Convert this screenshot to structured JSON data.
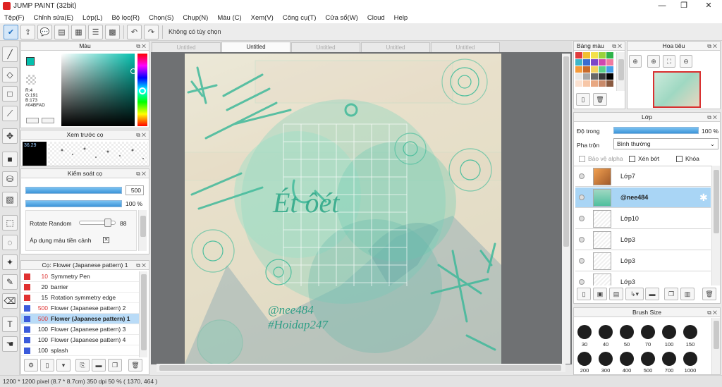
{
  "window": {
    "title": "JUMP PAINT (32bit)"
  },
  "menu": [
    "Tệp(F)",
    "Chỉnh sửa(E)",
    "Lớp(L)",
    "Bộ lọc(R)",
    "Chọn(S)",
    "Chụp(N)",
    "Màu (C)",
    "Xem(V)",
    "Công cụ(T)",
    "Cửa sổ(W)",
    "Cloud",
    "Help"
  ],
  "toolbar": {
    "hint": "Không có tùy chọn"
  },
  "tabs": [
    "Untitled",
    "Untitled",
    "Untitled",
    "Untitled",
    "Untitled"
  ],
  "color_panel": {
    "title": "Màu",
    "r": "R:4",
    "g": "G:191",
    "b": "B:173",
    "hex": "#04BFAD",
    "current": "#04bfad"
  },
  "brush_preview": {
    "title": "Xem trước cọ",
    "size": "36.29"
  },
  "brush_control": {
    "title": "Kiểm soát cọ",
    "size": "500",
    "opacity": "100 %",
    "rotate_label": "Rotate Random",
    "rotate_value": "88",
    "apply_label": "Áp dụng màu tiền cảnh"
  },
  "brush_list": {
    "title": "Cọ: Flower (Japanese pattern) 1",
    "items": [
      {
        "size": "10",
        "name": "Symmetry Pen",
        "color": "#e03131"
      },
      {
        "size": "20",
        "name": "barrier",
        "color": "#e03131"
      },
      {
        "size": "15",
        "name": "Rotation symmetry edge",
        "color": "#e03131"
      },
      {
        "size": "500",
        "name": "Flower (Japanese pattern) 2",
        "color": "#3b5bdb"
      },
      {
        "size": "500",
        "name": "Flower (Japanese pattern) 1",
        "color": "#3b5bdb"
      },
      {
        "size": "100",
        "name": "Flower (Japanese pattern) 3",
        "color": "#3b5bdb"
      },
      {
        "size": "100",
        "name": "Flower (Japanese pattern) 4",
        "color": "#3b5bdb"
      },
      {
        "size": "100",
        "name": "splash",
        "color": "#3b5bdb"
      }
    ]
  },
  "palette_panel": {
    "title": "Bảng màu"
  },
  "navigator": {
    "title": "Hoa tiêu"
  },
  "layer_panel": {
    "title": "Lớp",
    "opacity_label": "Độ trong",
    "opacity_value": "100 %",
    "blend_label": "Pha trộn",
    "blend_value": "Bình thường",
    "protect_alpha": "Bảo vệ alpha",
    "clip": "Xén bớt",
    "lock": "Khóa",
    "layers": [
      "Lớp7",
      "@nee484",
      "Lớp10",
      "Lớp3",
      "Lớp3",
      "Lớp3"
    ]
  },
  "brush_size": {
    "title": "Brush Size",
    "sizes": [
      "30",
      "40",
      "50",
      "70",
      "100",
      "150",
      "200",
      "300",
      "400",
      "500",
      "700",
      "1000"
    ]
  },
  "art": {
    "line1": "@nee484",
    "line2": "#Hoidap247"
  },
  "status": {
    "text": "1200 * 1200 pixel   (8.7 * 8.7cm)   350 dpi   50 %   ( 1370, 464 )"
  }
}
